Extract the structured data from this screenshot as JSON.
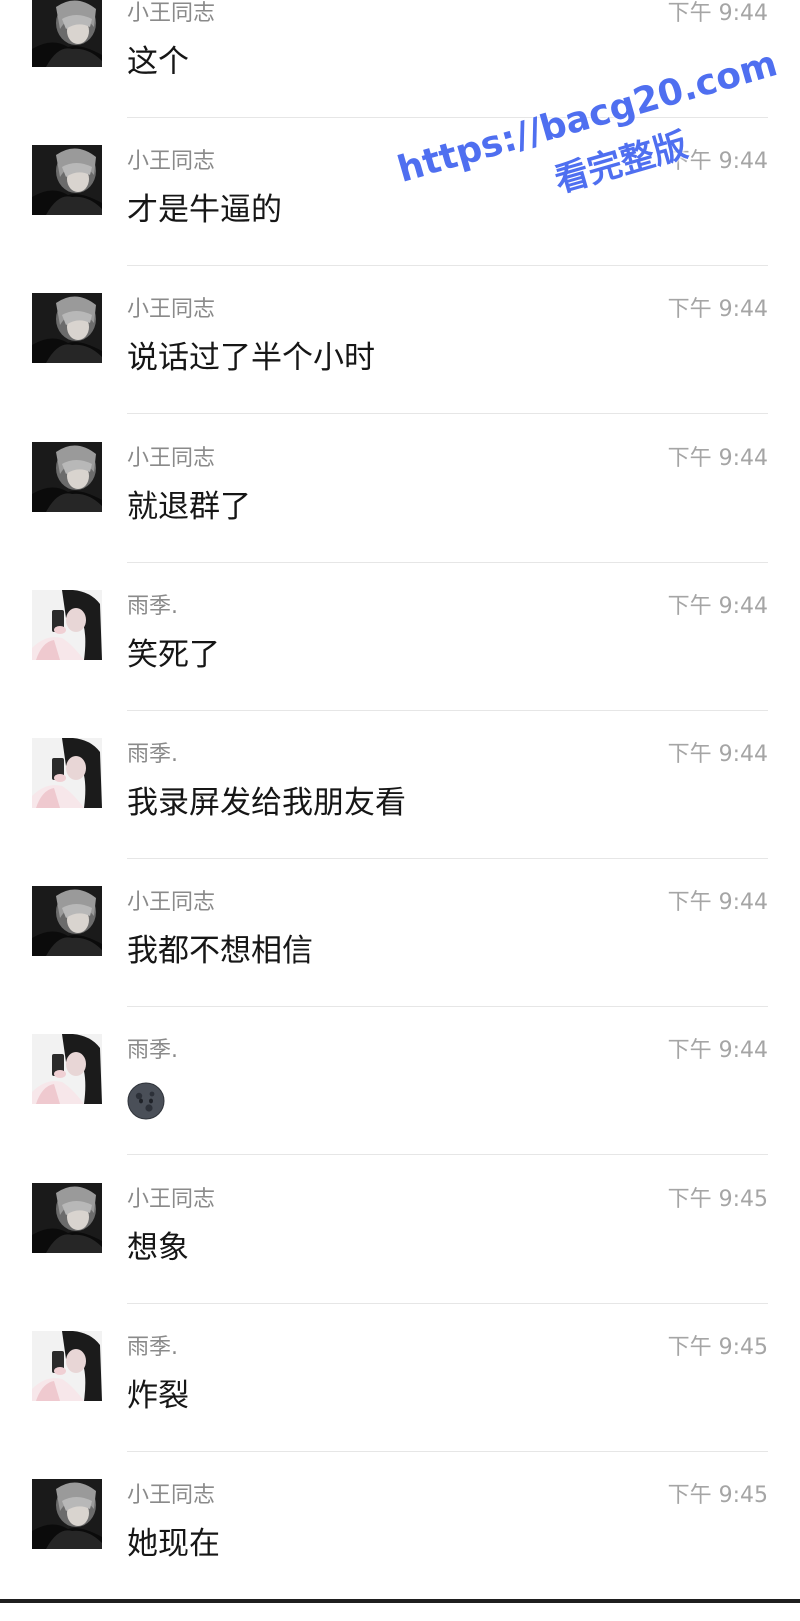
{
  "senders": {
    "wang": "小王同志",
    "yu": "雨季."
  },
  "messages": [
    {
      "sender": "小王同志",
      "time": "下午 9:44",
      "text": "这个",
      "avatar": "dark-haired-male-avatar"
    },
    {
      "sender": "小王同志",
      "time": "下午 9:44",
      "text": "才是牛逼的",
      "avatar": "dark-haired-male-avatar"
    },
    {
      "sender": "小王同志",
      "time": "下午 9:44",
      "text": "说话过了半个小时",
      "avatar": "dark-haired-male-avatar"
    },
    {
      "sender": "小王同志",
      "time": "下午 9:44",
      "text": "就退群了",
      "avatar": "dark-haired-male-avatar"
    },
    {
      "sender": "雨季.",
      "time": "下午 9:44",
      "text": "笑死了",
      "avatar": "girl-selfie-avatar"
    },
    {
      "sender": "雨季.",
      "time": "下午 9:44",
      "text": "我录屏发给我朋友看",
      "avatar": "girl-selfie-avatar"
    },
    {
      "sender": "小王同志",
      "time": "下午 9:44",
      "text": "我都不想相信",
      "avatar": "dark-haired-male-avatar"
    },
    {
      "sender": "雨季.",
      "time": "下午 9:44",
      "text": "",
      "emoji": "new-moon-face-icon",
      "avatar": "girl-selfie-avatar"
    },
    {
      "sender": "小王同志",
      "time": "下午 9:45",
      "text": "想象",
      "avatar": "dark-haired-male-avatar"
    },
    {
      "sender": "雨季.",
      "time": "下午 9:45",
      "text": "炸裂",
      "avatar": "girl-selfie-avatar"
    },
    {
      "sender": "小王同志",
      "time": "下午 9:45",
      "text": "她现在",
      "avatar": "dark-haired-male-avatar"
    }
  ],
  "watermark": {
    "url": "https://bacg20.com",
    "subtitle": "看完整版",
    "color": "#4f6ff0"
  },
  "colors": {
    "sender": "#8a8a8a",
    "time": "#a5a5a5",
    "text": "#161616",
    "divider": "#e6e6e6"
  }
}
